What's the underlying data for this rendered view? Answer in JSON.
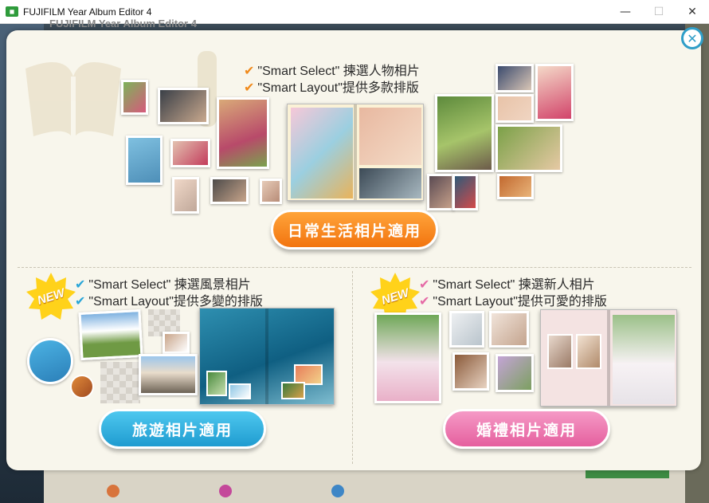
{
  "window": {
    "title": "FUJIFILM Year Album Editor 4",
    "icon": "app-icon",
    "minimize": "—",
    "maximize": "☐",
    "close": "✕"
  },
  "background": {
    "ghost_title": "FUJIFILM Year Album Editor 4"
  },
  "dialog": {
    "close_symbol": "✕",
    "daily": {
      "features": [
        {
          "check": "✔",
          "text": "\"Smart Select\" 揀選人物相片",
          "check_color": "#f08a1c"
        },
        {
          "check": "✔",
          "text": "\"Smart Layout\"提供多款排版",
          "check_color": "#f08a1c"
        }
      ],
      "button": "日常生活相片適用",
      "accent": "#f38a20"
    },
    "travel": {
      "badge": "NEW",
      "features": [
        {
          "check": "✔",
          "text": "\"Smart Select\" 揀選風景相片",
          "check_color": "#2aa6d8"
        },
        {
          "check": "✔",
          "text": "\"Smart Layout\"提供多變的排版",
          "check_color": "#2aa6d8"
        }
      ],
      "button": "旅遊相片適用",
      "accent": "#2aa6d8"
    },
    "wedding": {
      "badge": "NEW",
      "features": [
        {
          "check": "✔",
          "text": "\"Smart Select\" 揀選新人相片",
          "check_color": "#e56aa6"
        },
        {
          "check": "✔",
          "text": "\"Smart Layout\"提供可愛的排版",
          "check_color": "#e56aa6"
        }
      ],
      "button": "婚禮相片適用",
      "accent": "#e56aa6"
    }
  }
}
